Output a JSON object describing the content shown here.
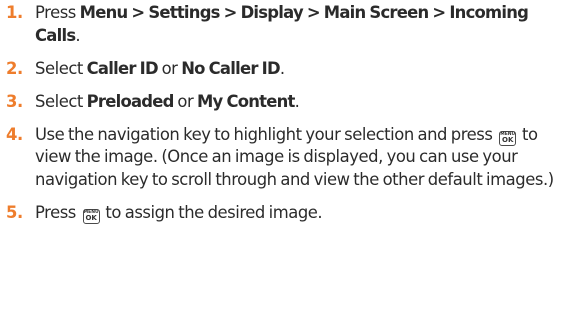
{
  "steps": [
    {
      "number": "1.",
      "parts": [
        {
          "t": "Press "
        },
        {
          "b": "Menu > Settings > Display > Main Screen > Incoming Calls"
        },
        {
          "t": "."
        }
      ]
    },
    {
      "number": "2.",
      "parts": [
        {
          "t": "Select "
        },
        {
          "b": "Caller ID"
        },
        {
          "t": " or "
        },
        {
          "b": "No Caller ID"
        },
        {
          "t": "."
        }
      ]
    },
    {
      "number": "3.",
      "parts": [
        {
          "t": "Select "
        },
        {
          "b": "Preloaded"
        },
        {
          "t": " or "
        },
        {
          "b": "My Content"
        },
        {
          "t": "."
        }
      ]
    },
    {
      "number": "4.",
      "parts": [
        {
          "t": "Use the navigation key to highlight your selection and press "
        },
        {
          "key": "menu-ok-key"
        },
        {
          "t": " to view the image. (Once an image is displayed, you can use your navigation key to scroll through and view the other default images.)"
        }
      ]
    },
    {
      "number": "5.",
      "parts": [
        {
          "t": "Press "
        },
        {
          "key": "menu-ok-key"
        },
        {
          "t": " to assign the desired image."
        }
      ]
    }
  ],
  "key_icon": {
    "top": "MENU",
    "bottom": "OK"
  },
  "colors": {
    "step_number": "#ee7d2c",
    "text": "#2b2b2b"
  }
}
